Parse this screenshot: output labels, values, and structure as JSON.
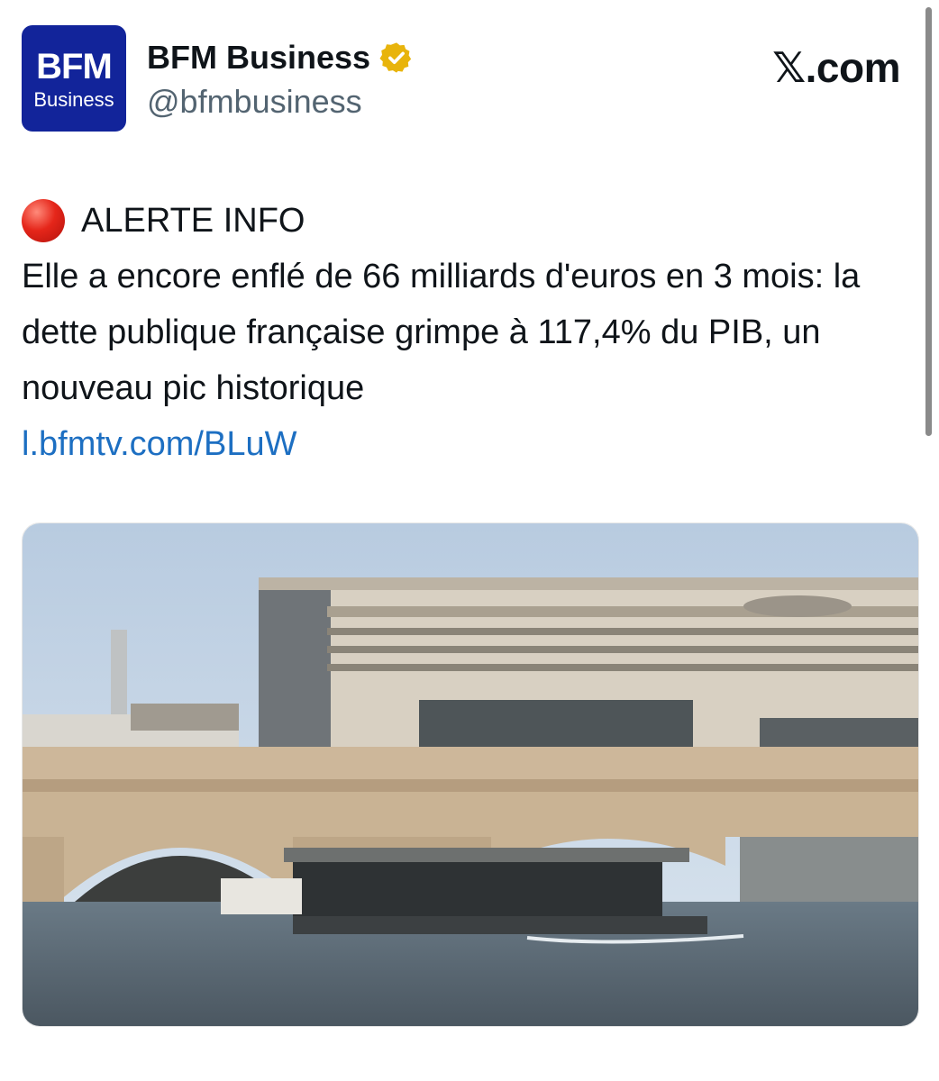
{
  "account": {
    "avatar_line1": "BFM",
    "avatar_line2": "Business",
    "display_name": "BFM Business",
    "handle": "@bfmbusiness",
    "avatar_color": "#12249a",
    "verified_color": "#e8b40c"
  },
  "site_label": "𝕏.com",
  "tweet": {
    "alert_icon": "red-circle-icon",
    "alert_label": "ALERTE INFO",
    "text": "Elle a encore enflé de 66 milliards d'euros en 3 mois: la dette publique française grimpe à 117,4% du PIB, un nouveau pic historique",
    "link": "l.bfmtv.com/BLuW",
    "link_color": "#1d6fc2"
  },
  "media": {
    "kind": "photo"
  }
}
